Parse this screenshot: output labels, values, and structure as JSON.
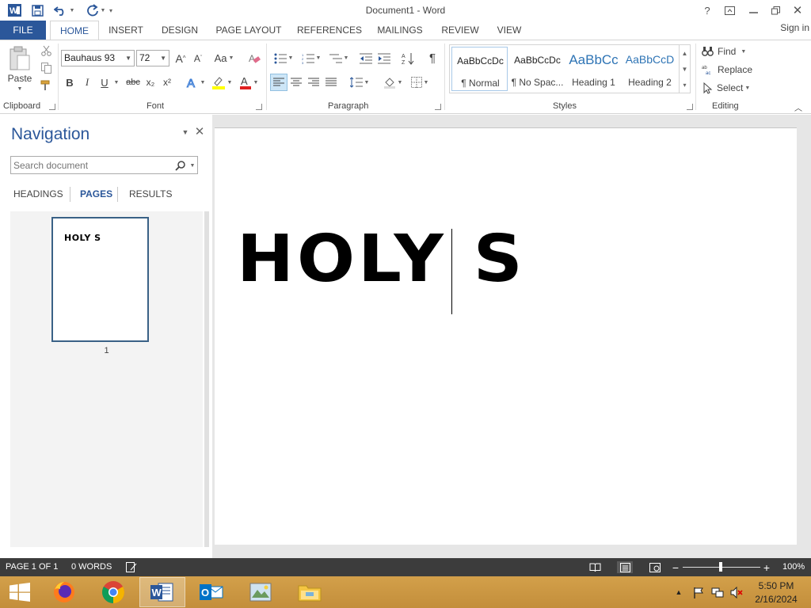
{
  "window": {
    "title": "Document1 - Word",
    "signin": "Sign in"
  },
  "tabs": [
    "FILE",
    "HOME",
    "INSERT",
    "DESIGN",
    "PAGE LAYOUT",
    "REFERENCES",
    "MAILINGS",
    "REVIEW",
    "VIEW"
  ],
  "ribbon": {
    "clipboard": {
      "paste": "Paste",
      "label": "Clipboard"
    },
    "font": {
      "label": "Font",
      "family": "Bauhaus 93",
      "size": "72",
      "bold": "B",
      "italic": "I",
      "underline": "U",
      "strike": "abc",
      "subscript": "x₂",
      "superscript": "x²",
      "case": "Aa"
    },
    "paragraph": {
      "label": "Paragraph"
    },
    "styles": {
      "label": "Styles",
      "items": [
        {
          "preview": "AaBbCcDc",
          "name": "¶ Normal"
        },
        {
          "preview": "AaBbCcDc",
          "name": "¶ No Spac..."
        },
        {
          "preview": "AaBbCc",
          "name": "Heading 1"
        },
        {
          "preview": "AaBbCcD",
          "name": "Heading 2"
        }
      ]
    },
    "editing": {
      "label": "Editing",
      "find": "Find",
      "replace": "Replace",
      "select": "Select"
    }
  },
  "navigation": {
    "title": "Navigation",
    "search_placeholder": "Search document",
    "tabs": [
      "HEADINGS",
      "PAGES",
      "RESULTS"
    ],
    "active_tab": "PAGES",
    "thumbnail_text": "HOLY S",
    "page_number": "1"
  },
  "document": {
    "text": "HOLY S"
  },
  "status": {
    "page": "PAGE 1 OF 1",
    "words": "0 WORDS",
    "zoom": "100%"
  },
  "taskbar": {
    "time": "5:50 PM",
    "date": "2/16/2024"
  },
  "colors": {
    "accent": "#2b579a",
    "statusbar": "#3c3c3c",
    "taskbar": "#c8963f"
  }
}
